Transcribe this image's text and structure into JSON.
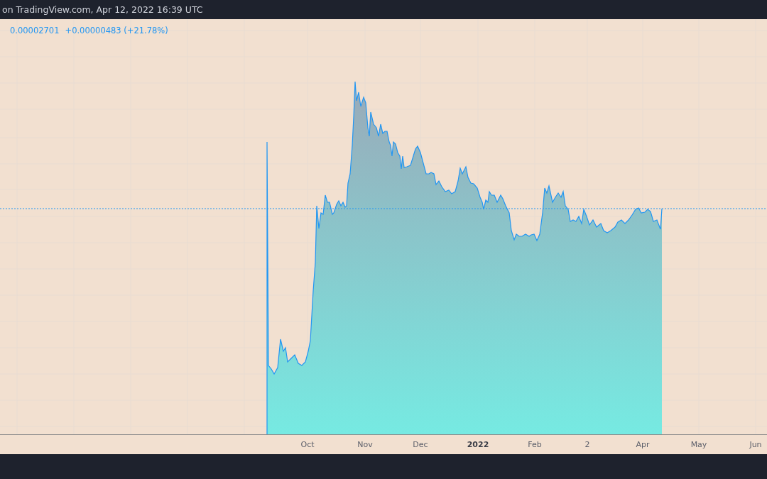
{
  "header": {
    "text": "on TradingView.com, Apr 12, 2022 16:39 UTC"
  },
  "legend": {
    "price": "0.00002701",
    "change": "+0.00000483 (+21.78%)"
  },
  "time_axis": {
    "labels": [
      {
        "text": "Oct",
        "kind": "month"
      },
      {
        "text": "Nov",
        "kind": "month"
      },
      {
        "text": "Dec",
        "kind": "month"
      },
      {
        "text": "2022",
        "kind": "year"
      },
      {
        "text": "Feb",
        "kind": "month"
      },
      {
        "text": "2",
        "kind": "month"
      },
      {
        "text": "Apr",
        "kind": "month"
      },
      {
        "text": "May",
        "kind": "month"
      },
      {
        "text": "Jun",
        "kind": "month"
      }
    ]
  }
}
